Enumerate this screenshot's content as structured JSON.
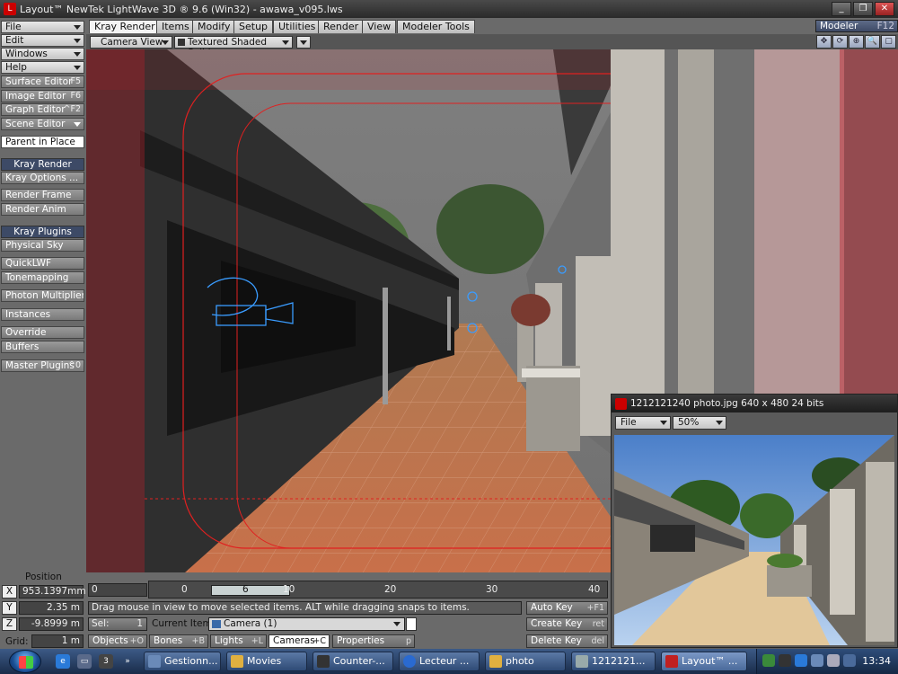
{
  "window": {
    "title": "Layout™ NewTek LightWave 3D ® 9.6  (Win32) - awawa_v095.lws",
    "buttons": [
      "_",
      "❐",
      "✕"
    ]
  },
  "left_menu": {
    "file": "File",
    "edit": "Edit",
    "windows": "Windows",
    "help": "Help",
    "surface_editor": {
      "label": "Surface Editor",
      "shortcut": "F5"
    },
    "image_editor": {
      "label": "Image Editor",
      "shortcut": "F6"
    },
    "graph_editor": {
      "label": "Graph Editor",
      "shortcut": "^F2"
    },
    "scene_editor": "Scene Editor",
    "parent_in_place": "Parent in Place",
    "kray_render_header": "Kray Render",
    "kray_options": "Kray Options ...",
    "render_frame": "Render Frame",
    "render_anim": "Render Anim",
    "kray_plugins_header": "Kray Plugins",
    "physical_sky": "Physical Sky",
    "quicklwf": "QuickLWF",
    "tonemapping": "Tonemapping",
    "photon_multiplier": "Photon Multiplier",
    "instances": "Instances",
    "override": "Override",
    "buffers": "Buffers",
    "master_plugins": {
      "label": "Master Plugins",
      "shortcut": "^0"
    }
  },
  "tabs": [
    "Kray Render",
    "Items",
    "Modify",
    "Setup",
    "Utilities",
    "Render",
    "View",
    "Modeler Tools"
  ],
  "modeler": {
    "label": "Modeler",
    "shortcut": "F12"
  },
  "viewport_toolbar": {
    "view_mode": "Camera View",
    "shading": "Textured Shaded Solid"
  },
  "image_viewer": {
    "title": "1212121240 photo.jpg  640 x 480 24 bits",
    "file_menu": "File",
    "zoom": "50%"
  },
  "bottom": {
    "position_label": "Position",
    "x": {
      "axis": "X",
      "value": "953.1397mm"
    },
    "y": {
      "axis": "Y",
      "value": "2.35 m"
    },
    "z": {
      "axis": "Z",
      "value": "-9.8999 m"
    },
    "grid": {
      "label": "Grid:",
      "value": "1 m"
    },
    "current_frame": "0",
    "timeline_ticks": [
      "0",
      "6",
      "10",
      "20",
      "30",
      "40"
    ],
    "status_message": "Drag mouse in view to move selected items. ALT while dragging snaps to items.",
    "sel": {
      "label": "Sel:",
      "value": "1"
    },
    "current_item_label": "Current Item",
    "current_item_value": "Camera (1)",
    "auto_key": {
      "label": "Auto Key",
      "shortcut": "+F1"
    },
    "create_key": {
      "label": "Create Key",
      "shortcut": "ret"
    },
    "delete_key": {
      "label": "Delete Key",
      "shortcut": "del"
    },
    "objects": {
      "label": "Objects",
      "shortcut": "+O"
    },
    "bones": {
      "label": "Bones",
      "shortcut": "+B"
    },
    "lights": {
      "label": "Lights",
      "shortcut": "+L"
    },
    "cameras": {
      "label": "Cameras",
      "shortcut": "+C"
    },
    "properties": {
      "label": "Properties",
      "shortcut": "p"
    }
  },
  "taskbar": {
    "items": [
      "Gestionn...",
      "Movies",
      "Counter-...",
      "Lecteur ...",
      "photo",
      "1212121...",
      "Layout™ ..."
    ],
    "clock": "13:34"
  }
}
